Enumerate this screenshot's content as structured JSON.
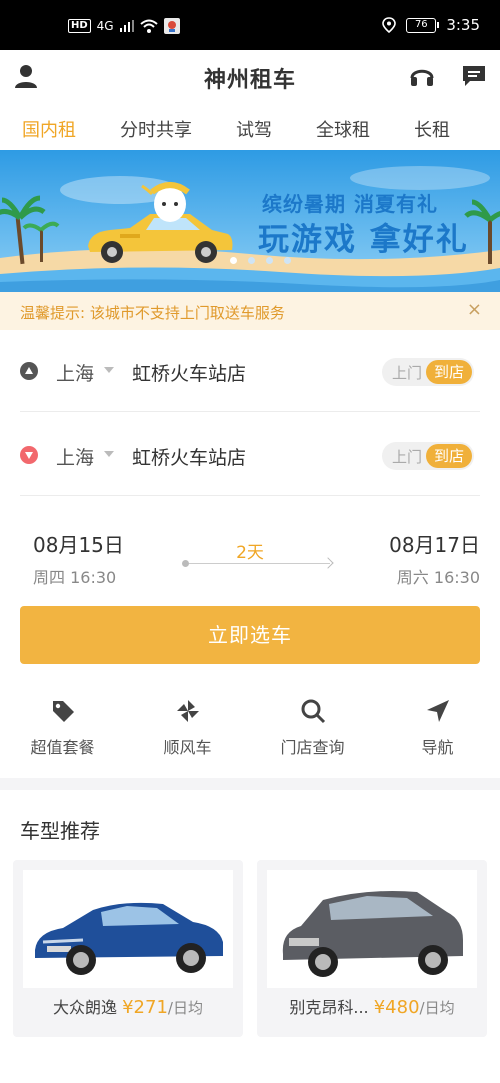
{
  "status_bar": {
    "network": "4G",
    "battery": "76",
    "time": "3:35"
  },
  "header": {
    "title": "神州租车"
  },
  "tabs": [
    {
      "label": "国内租",
      "active": true
    },
    {
      "label": "分时共享",
      "active": false
    },
    {
      "label": "试驾",
      "active": false
    },
    {
      "label": "全球租",
      "active": false
    },
    {
      "label": "长租",
      "active": false
    }
  ],
  "banner": {
    "line1": "缤纷暑期  消夏有礼",
    "line2": "玩游戏 拿好礼",
    "slide_index": 1,
    "slide_count": 4
  },
  "notice": {
    "text": "温馨提示: 该城市不支持上门取送车服务",
    "close": "×"
  },
  "pickup": {
    "city": "上海",
    "store": "虹桥火车站店",
    "toggle_off": "上门",
    "toggle_on": "到店",
    "marker_color": "#555555"
  },
  "return": {
    "city": "上海",
    "store": "虹桥火车站店",
    "toggle_off": "上门",
    "toggle_on": "到店",
    "marker_color": "#f2686d"
  },
  "dates": {
    "start_date": "08月15日",
    "start_time": "周四 16:30",
    "duration": "2天",
    "end_date": "08月17日",
    "end_time": "周六 16:30"
  },
  "select_button": "立即选车",
  "quick_links": [
    {
      "label": "超值套餐",
      "icon": "tag-icon"
    },
    {
      "label": "顺风车",
      "icon": "pinwheel-icon"
    },
    {
      "label": "门店查询",
      "icon": "search-icon"
    },
    {
      "label": "导航",
      "icon": "navigation-icon"
    }
  ],
  "recommend": {
    "title": "车型推荐",
    "cars": [
      {
        "name": "大众朗逸",
        "price": "¥271",
        "unit": "/日均",
        "color": "#1f4f9a"
      },
      {
        "name": "别克昂科...",
        "price": "¥480",
        "unit": "/日均",
        "color": "#5b5d63"
      }
    ]
  },
  "colors": {
    "accent": "#f0a625",
    "button": "#f2b441",
    "notice_bg": "#fdf3e2",
    "banner_sky": "#3aa6ea"
  }
}
